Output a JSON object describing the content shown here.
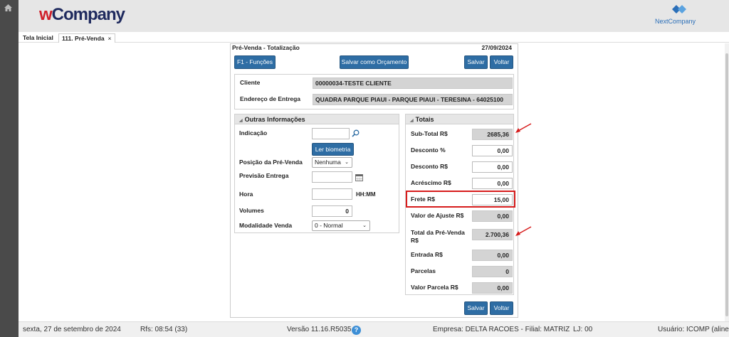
{
  "header": {
    "logo_w": "w",
    "logo_rest": "Company",
    "right_logo": "NextCompany"
  },
  "tabs": [
    {
      "label": "Tela Inicial"
    },
    {
      "label": "111. Pré-Venda",
      "close": "×"
    }
  ],
  "panel": {
    "title": "Pré-Venda - Totalização",
    "date": "27/09/2024",
    "btn_funcoes": "F1 - Funções",
    "btn_orcamento": "Salvar como Orçamento",
    "btn_salvar": "Salvar",
    "btn_voltar": "Voltar"
  },
  "cliente": {
    "label": "Cliente",
    "value": "00000034-TESTE CLIENTE",
    "endereco_label": "Endereço de Entrega",
    "endereco_value": "QUADRA PARQUE PIAUI - PARQUE PIAUI - TERESINA - 64025100"
  },
  "outras": {
    "title": "Outras Informações",
    "indicacao_label": "Indicação",
    "biometria_button": "Ler biometria",
    "posicao_label": "Posição da Pré-Venda",
    "posicao_value": "Nenhuma",
    "previsao_label": "Previsão Entrega",
    "hora_label": "Hora",
    "hora_format": "HH:MM",
    "volumes_label": "Volumes",
    "volumes_value": "0",
    "modalidade_label": "Modalidade Venda",
    "modalidade_value": "0 - Normal"
  },
  "totais": {
    "title": "Totais",
    "subtotal_label": "Sub-Total R$",
    "subtotal_value": "2685,36",
    "desconto_pct_label": "Desconto %",
    "desconto_pct_value": "0,00",
    "desconto_label": "Desconto R$",
    "desconto_value": "0,00",
    "acrescimo_label": "Acréscimo R$",
    "acrescimo_value": "0,00",
    "frete_label": "Frete R$",
    "frete_value": "15,00",
    "ajuste_label": "Valor de Ajuste R$",
    "ajuste_value": "0,00",
    "total_label_1": "Total da Pré-Venda",
    "total_label_2": "R$",
    "total_value": "2.700,36",
    "entrada_label": "Entrada R$",
    "entrada_value": "0,00",
    "parcelas_label": "Parcelas",
    "parcelas_value": "0",
    "valor_parcela_label": "Valor Parcela R$",
    "valor_parcela_value": "0,00"
  },
  "status": {
    "date": "sexta, 27 de setembro de 2024",
    "rfs": "Rfs: 08:54 (33)",
    "version": "Versão 11.16.R5035",
    "help": "?",
    "empresa": "Empresa: DELTA RACOES - Filial: MATRIZ",
    "lj": "LJ: 00",
    "usuario": "Usuário: ICOMP (aline)"
  },
  "colors": {
    "brand_red": "#d0202a",
    "brand_navy": "#1f2a5e",
    "button_blue": "#2e6da4",
    "highlight_red": "#d71c1c"
  }
}
